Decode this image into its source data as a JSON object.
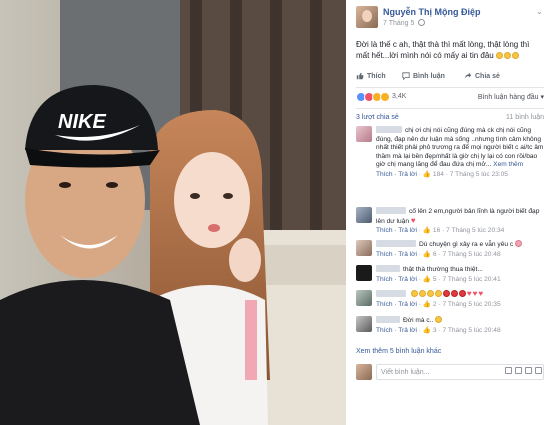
{
  "post": {
    "author": "Nguyễn Thị Mộng Điệp",
    "date": "7 Tháng 5",
    "text": "Đời là thế c ah, thật thà thì mất lòng, thật lòng thì mất hết...lời mình nói có mấy ai tin đâu",
    "actions": {
      "like": "Thích",
      "comment": "Bình luận",
      "share": "Chia sẻ"
    },
    "reaction_count": "3,4K",
    "sort_label": "Bình luận hàng đầu ▾",
    "shares": "3 lượt chia sẻ",
    "comment_count": "11 bình luận"
  },
  "comments": [
    {
      "text": "chị ơi chị nói cũng đúng mà ck chị nói cũng đúng, đạp nên dư luận mà sống ..nhưng tình cảm không nhất thiết phải phô trương ra để mọi người biết c ai/tc âm thầm mà lại bền đẹp/nhất là giờ chị ly lại có con rồi/bao giờ chị mang lăng để đau đứa chị mở...",
      "see_more": "Xem thêm",
      "reply": "Thích · Trả lời",
      "likes": "184",
      "time": "· 7 Tháng 5 lúc 23:05"
    },
    {
      "text": "cố lên 2 em,người bản lĩnh là người biết đạp lên dư luận",
      "reply": "Thích · Trả lời",
      "likes": "16",
      "time": "· 7 Tháng 5 lúc 20:34"
    },
    {
      "text": "Dù chuyện gì xảy ra e vẫn yêu c",
      "reply": "Thích · Trả lời",
      "likes": "6",
      "time": "· 7 Tháng 5 lúc 20:48"
    },
    {
      "text": "thật thà thường thua thiệt...",
      "reply": "Thích · Trả lời",
      "likes": "5",
      "time": "· 7 Tháng 5 lúc 20:41"
    },
    {
      "text": "",
      "reply": "Thích · Trả lời",
      "likes": "2",
      "time": "· 7 Tháng 5 lúc 20:35"
    },
    {
      "text": "Đời mà c..",
      "reply": "Thích · Trả lời",
      "likes": "3",
      "time": "· 7 Tháng 5 lúc 20:48"
    }
  ],
  "more_replies": "Xem thêm 5 bình luận khác",
  "composer_placeholder": "Viết bình luận...",
  "photo": {
    "cap_text": "NIKE"
  }
}
